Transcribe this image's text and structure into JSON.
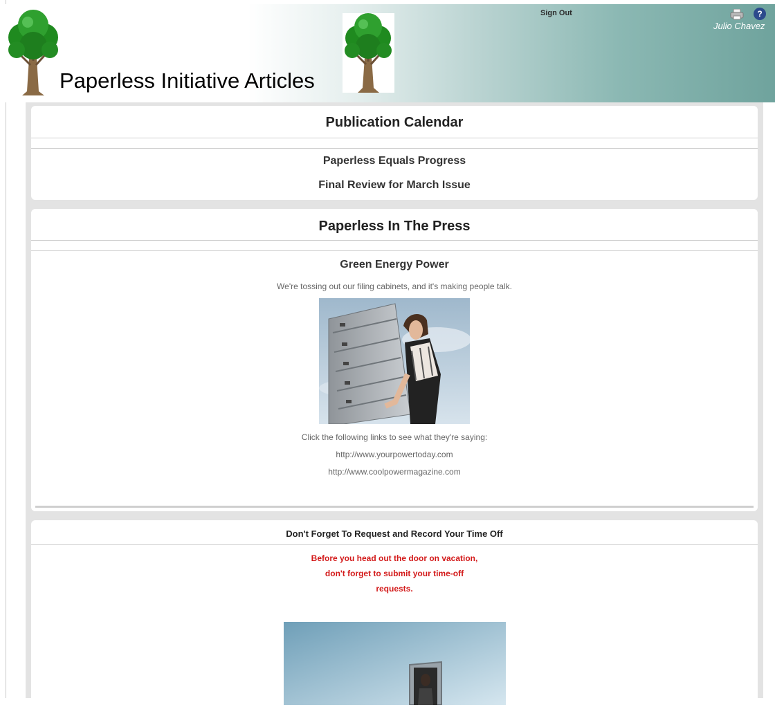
{
  "header": {
    "title": "Paperless Initiative Articles",
    "sign_out": "Sign Out",
    "user": "Julio Chavez",
    "help_glyph": "?",
    "icons": [
      "tree-icon",
      "printer-icon",
      "help-icon"
    ]
  },
  "calendar": {
    "heading": "Publication Calendar",
    "items": [
      "Paperless Equals Progress",
      "Final Review for March Issue"
    ]
  },
  "press": {
    "heading": "Paperless In The Press",
    "article_title": "Green Energy Power",
    "lead": "We're tossing out our filing cabinets, and it's making people talk.",
    "cta": "Click the following links to see what they're saying:",
    "links": [
      "http://www.yourpowertoday.com",
      "http://www.coolpowermagazine.com"
    ]
  },
  "timeoff": {
    "heading": "Don't Forget To Request and Record Your Time Off",
    "lines": [
      "Before you head out the door on vacation,",
      "don't forget to submit your time-off",
      "requests."
    ]
  },
  "colors": {
    "header_teal": "#6fa39d",
    "alert_red": "#d31a1a",
    "help_blue": "#2c4a8c"
  }
}
